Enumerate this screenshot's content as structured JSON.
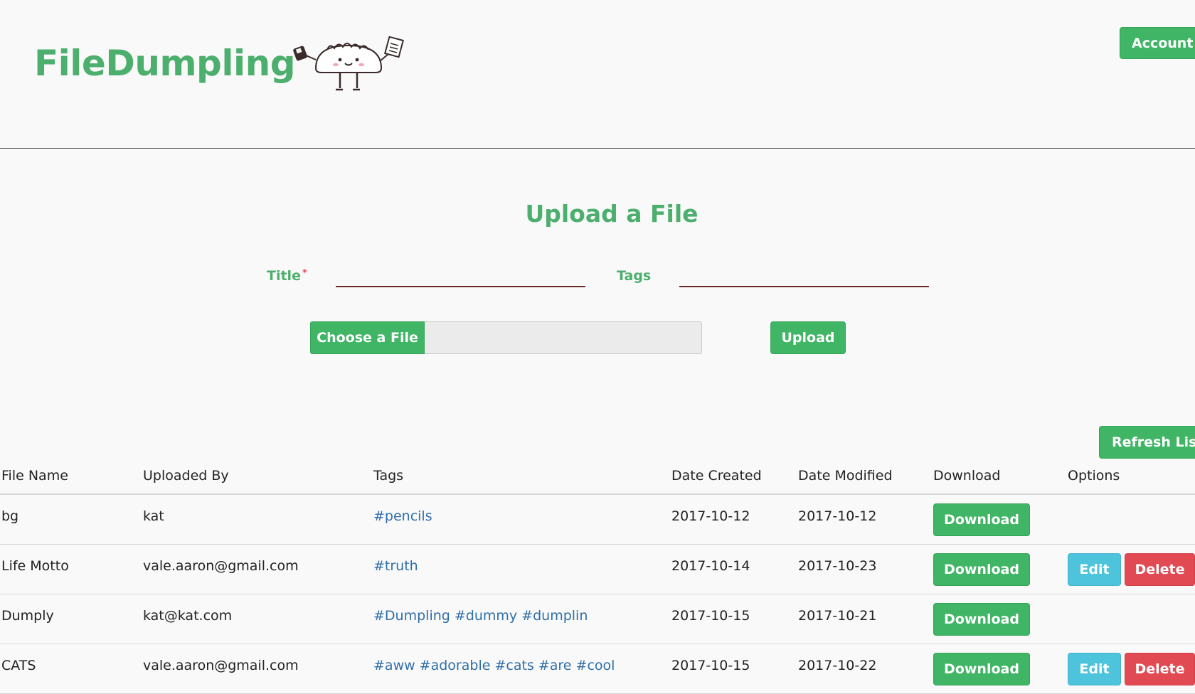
{
  "header": {
    "brand": "FileDumpling",
    "account_label": "Account"
  },
  "upload": {
    "title": "Upload a File",
    "title_label": "Title",
    "required_marker": "*",
    "title_value": "",
    "tags_label": "Tags",
    "tags_value": "",
    "choose_label": "Choose a File",
    "chosen_file": "",
    "upload_label": "Upload"
  },
  "list": {
    "refresh_label": "Refresh List",
    "columns": [
      "File Name",
      "Uploaded By",
      "Tags",
      "Date Created",
      "Date Modified",
      "Download",
      "Options"
    ],
    "rows": [
      {
        "name": "bg",
        "user": "kat",
        "tags": "#pencils",
        "created": "2017-10-12",
        "modified": "2017-10-12",
        "download": "Download",
        "edit": "",
        "delete": ""
      },
      {
        "name": "Life Motto",
        "user": "vale.aaron@gmail.com",
        "tags": "#truth",
        "created": "2017-10-14",
        "modified": "2017-10-23",
        "download": "Download",
        "edit": "Edit",
        "delete": "Delete"
      },
      {
        "name": "Dumply",
        "user": "kat@kat.com",
        "tags": "#Dumpling #dummy #dumplin",
        "created": "2017-10-15",
        "modified": "2017-10-21",
        "download": "Download",
        "edit": "",
        "delete": ""
      },
      {
        "name": "CATS",
        "user": "vale.aaron@gmail.com",
        "tags": "#aww #adorable #cats #are #cool",
        "created": "2017-10-15",
        "modified": "2017-10-22",
        "download": "Download",
        "edit": "Edit",
        "delete": "Delete"
      }
    ]
  },
  "colors": {
    "brand_green": "#4caf6d",
    "button_green": "#3fb565",
    "edit_blue": "#4dc3dc",
    "delete_red": "#e14a52",
    "tag_link": "#2f6ea8"
  }
}
